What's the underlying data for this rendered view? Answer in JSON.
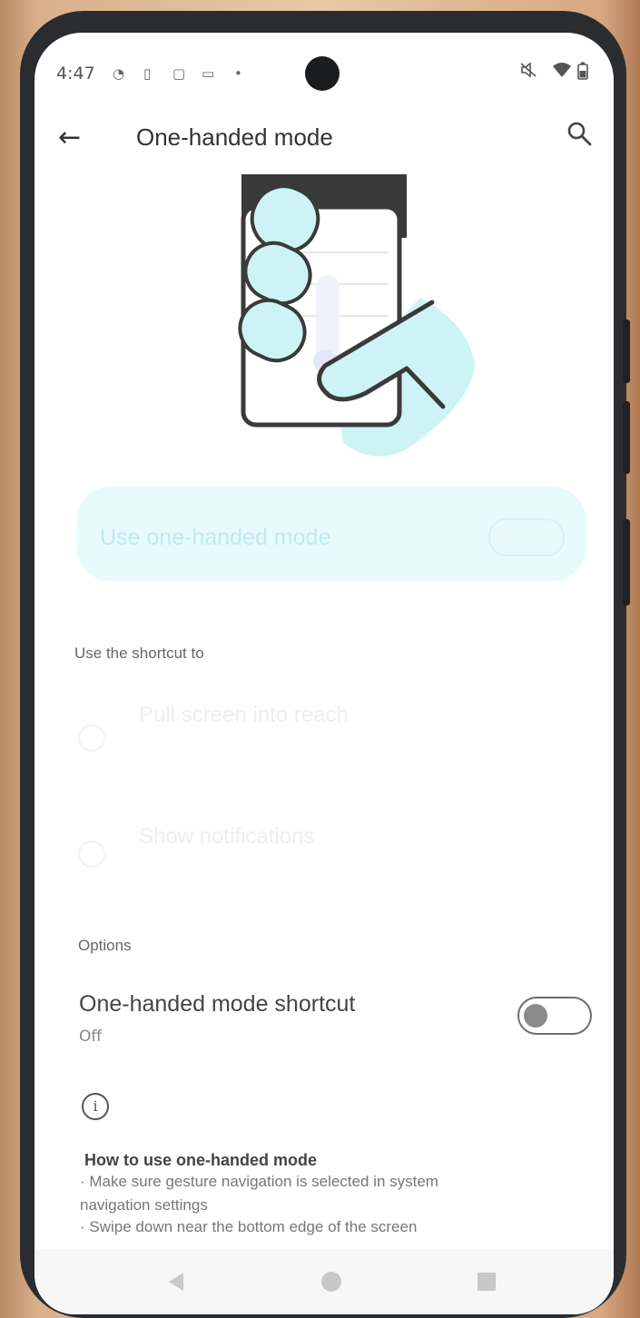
{
  "status_bar": {
    "time": "4:47",
    "left_icons": [
      "face-icon",
      "sim-icon",
      "clipboard-icon",
      "chat-icon",
      "dot-icon"
    ],
    "right_icons": [
      "mute-icon",
      "wifi-icon",
      "battery-icon"
    ]
  },
  "app_bar": {
    "back_icon": "←",
    "title": "One-handed mode",
    "search_icon": "search-icon"
  },
  "main_switch": {
    "label": "Use one-handed mode",
    "state": "off"
  },
  "shortcut_section": {
    "header": "Use the shortcut to",
    "options": [
      {
        "label": "Pull screen into reach",
        "selected": false
      },
      {
        "label": "Show notifications",
        "selected": false
      }
    ]
  },
  "options_section": {
    "header": "Options",
    "shortcut_title": "One-handed mode shortcut",
    "shortcut_status": "Off",
    "shortcut_state": "off"
  },
  "info": {
    "icon": "i",
    "title": "How to use one-handed mode",
    "lines": [
      "· Make sure gesture navigation is selected in system",
      "navigation settings",
      "· Swipe down near the bottom edge of the screen"
    ]
  },
  "nav_bar": [
    "back-icon",
    "home-icon",
    "recents-icon"
  ],
  "colors": {
    "accent_light": "#e8fbfc",
    "accent_text": "#bfeaf0",
    "illustration_fill": "#cdf3f5"
  }
}
